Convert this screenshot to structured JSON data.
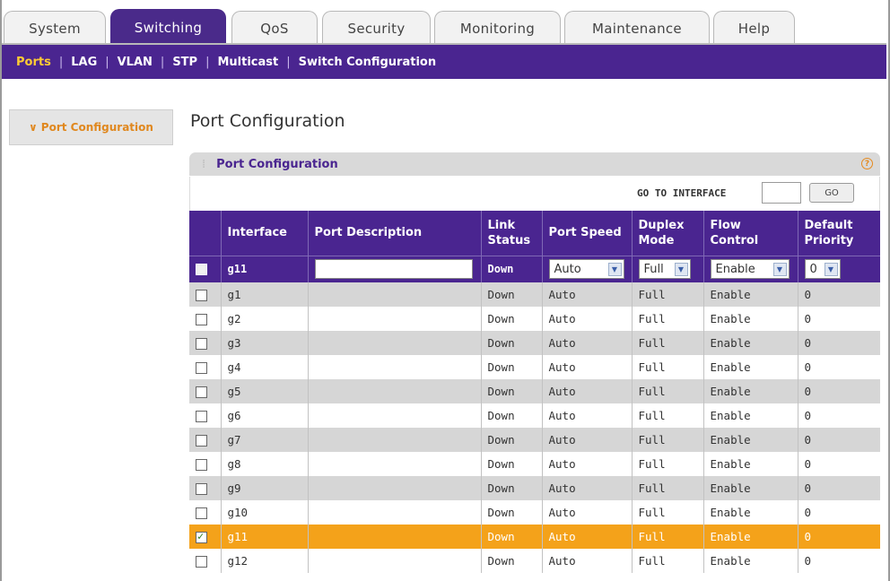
{
  "tabs": [
    {
      "label": "System",
      "active": false
    },
    {
      "label": "Switching",
      "active": true
    },
    {
      "label": "QoS",
      "active": false
    },
    {
      "label": "Security",
      "active": false
    },
    {
      "label": "Monitoring",
      "active": false
    },
    {
      "label": "Maintenance",
      "active": false
    },
    {
      "label": "Help",
      "active": false
    }
  ],
  "subnav": [
    {
      "label": "Ports",
      "active": true
    },
    {
      "label": "LAG",
      "active": false
    },
    {
      "label": "VLAN",
      "active": false
    },
    {
      "label": "STP",
      "active": false
    },
    {
      "label": "Multicast",
      "active": false
    },
    {
      "label": "Switch Configuration",
      "active": false
    }
  ],
  "leftnav": {
    "label": "Port Configuration",
    "arrow": "∨"
  },
  "page_title": "Port Configuration",
  "panel": {
    "title": "Port Configuration",
    "help_icon": "?",
    "goto_label": "GO TO INTERFACE",
    "goto_value": "",
    "go_label": "GO"
  },
  "table": {
    "headers": [
      "",
      "Interface",
      "Port Description",
      "Link Status",
      "Port Speed",
      "Duplex Mode",
      "Flow Control",
      "Default Priority"
    ],
    "edit_row": {
      "interface": "g11",
      "description": "",
      "link_status": "Down",
      "port_speed": "Auto",
      "duplex_mode": "Full",
      "flow_control": "Enable",
      "default_priority": "0"
    },
    "rows": [
      {
        "interface": "g1",
        "description": "",
        "link_status": "Down",
        "port_speed": "Auto",
        "duplex_mode": "Full",
        "flow_control": "Enable",
        "default_priority": "0",
        "checked": false
      },
      {
        "interface": "g2",
        "description": "",
        "link_status": "Down",
        "port_speed": "Auto",
        "duplex_mode": "Full",
        "flow_control": "Enable",
        "default_priority": "0",
        "checked": false
      },
      {
        "interface": "g3",
        "description": "",
        "link_status": "Down",
        "port_speed": "Auto",
        "duplex_mode": "Full",
        "flow_control": "Enable",
        "default_priority": "0",
        "checked": false
      },
      {
        "interface": "g4",
        "description": "",
        "link_status": "Down",
        "port_speed": "Auto",
        "duplex_mode": "Full",
        "flow_control": "Enable",
        "default_priority": "0",
        "checked": false
      },
      {
        "interface": "g5",
        "description": "",
        "link_status": "Down",
        "port_speed": "Auto",
        "duplex_mode": "Full",
        "flow_control": "Enable",
        "default_priority": "0",
        "checked": false
      },
      {
        "interface": "g6",
        "description": "",
        "link_status": "Down",
        "port_speed": "Auto",
        "duplex_mode": "Full",
        "flow_control": "Enable",
        "default_priority": "0",
        "checked": false
      },
      {
        "interface": "g7",
        "description": "",
        "link_status": "Down",
        "port_speed": "Auto",
        "duplex_mode": "Full",
        "flow_control": "Enable",
        "default_priority": "0",
        "checked": false
      },
      {
        "interface": "g8",
        "description": "",
        "link_status": "Down",
        "port_speed": "Auto",
        "duplex_mode": "Full",
        "flow_control": "Enable",
        "default_priority": "0",
        "checked": false
      },
      {
        "interface": "g9",
        "description": "",
        "link_status": "Down",
        "port_speed": "Auto",
        "duplex_mode": "Full",
        "flow_control": "Enable",
        "default_priority": "0",
        "checked": false
      },
      {
        "interface": "g10",
        "description": "",
        "link_status": "Down",
        "port_speed": "Auto",
        "duplex_mode": "Full",
        "flow_control": "Enable",
        "default_priority": "0",
        "checked": false
      },
      {
        "interface": "g11",
        "description": "",
        "link_status": "Down",
        "port_speed": "Auto",
        "duplex_mode": "Full",
        "flow_control": "Enable",
        "default_priority": "0",
        "checked": true
      },
      {
        "interface": "g12",
        "description": "",
        "link_status": "Down",
        "port_speed": "Auto",
        "duplex_mode": "Full",
        "flow_control": "Enable",
        "default_priority": "0",
        "checked": false
      }
    ]
  },
  "colors": {
    "brand_purple": "#4a2590",
    "selected_row": "#f4a21a",
    "accent_orange": "#e0881f",
    "alt_row": "#d6d6d6"
  },
  "icons": {
    "select_arrow": "chevron-down-icon",
    "help": "help-icon",
    "checkbox_check": "check-icon"
  }
}
